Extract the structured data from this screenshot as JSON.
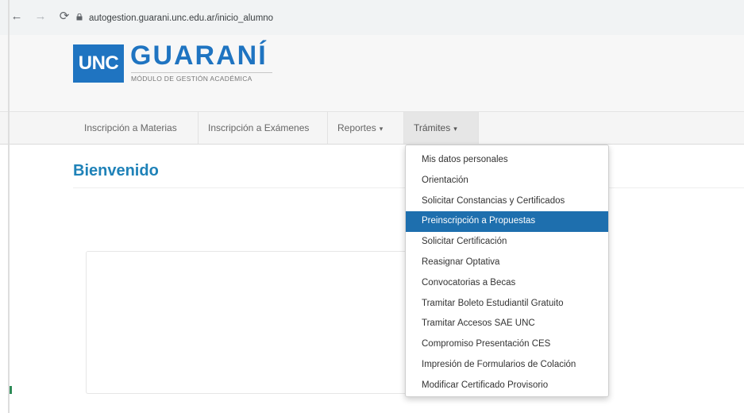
{
  "browser": {
    "url": "autogestion.guarani.unc.edu.ar/inicio_alumno",
    "back_glyph": "←",
    "forward_glyph": "→",
    "reload_glyph": "⟳"
  },
  "header": {
    "logo_text": "UNC",
    "title": "GUARANÍ",
    "subtitle": "MÓDULO DE GESTIÓN ACADÉMICA",
    "brand_color": "#1f74c1"
  },
  "menu": {
    "items": [
      {
        "label": "Inscripción a Materias"
      },
      {
        "label": "Inscripción a Exámenes"
      },
      {
        "label": "Reportes",
        "caret": "▾"
      },
      {
        "label": "Trámites",
        "caret": "▾",
        "open": true
      }
    ]
  },
  "main": {
    "welcome": "Bienvenido"
  },
  "dropdown": {
    "items": [
      "Mis datos personales",
      "Orientación",
      "Solicitar Constancias y Certificados",
      "Preinscripción a Propuestas",
      "Solicitar Certificación",
      "Reasignar Optativa",
      "Convocatorias a Becas",
      "Tramitar Boleto Estudiantil Gratuito",
      "Tramitar Accesos SAE UNC",
      "Compromiso Presentación CES",
      "Impresión de Formularios de Colación",
      "Modificar Certificado Provisorio"
    ],
    "active_index": 3,
    "active_color": "#1e6fae"
  }
}
